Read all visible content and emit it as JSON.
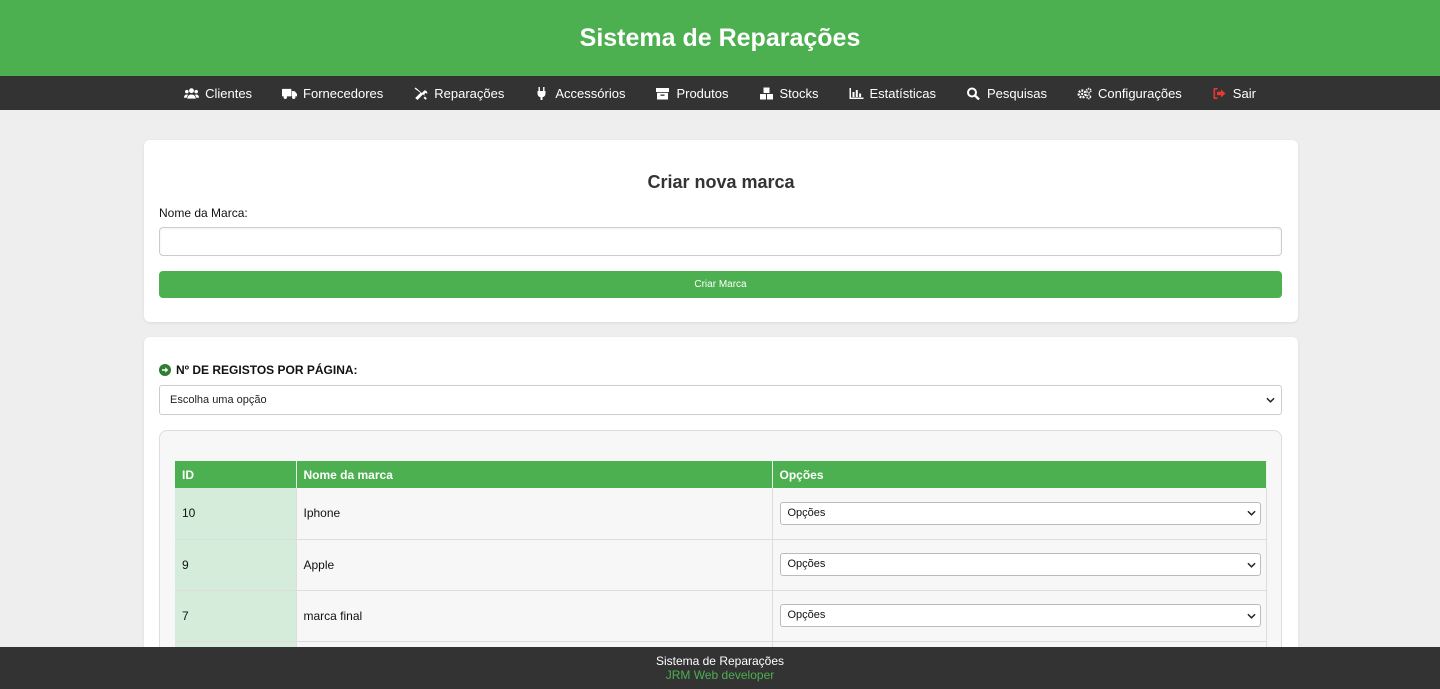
{
  "header": {
    "title": "Sistema de Reparações"
  },
  "nav": {
    "items": [
      {
        "label": "Clientes",
        "icon": "users-icon"
      },
      {
        "label": "Fornecedores",
        "icon": "truck-icon"
      },
      {
        "label": "Reparações",
        "icon": "tools-icon"
      },
      {
        "label": "Accessórios",
        "icon": "plug-icon"
      },
      {
        "label": "Produtos",
        "icon": "box-icon"
      },
      {
        "label": "Stocks",
        "icon": "boxes-icon"
      },
      {
        "label": "Estatísticas",
        "icon": "chart-icon"
      },
      {
        "label": "Pesquisas",
        "icon": "search-icon"
      },
      {
        "label": "Configurações",
        "icon": "gears-icon"
      },
      {
        "label": "Sair",
        "icon": "sign-out-icon"
      }
    ]
  },
  "create_form": {
    "title": "Criar nova marca",
    "name_label": "Nome da Marca:",
    "name_value": "",
    "submit_label": "Criar Marca"
  },
  "list": {
    "perpage_label": "Nº DE REGISTOS POR PÁGINA:",
    "perpage_value": "Escolha uma opção",
    "table": {
      "headers": [
        "ID",
        "Nome da marca",
        "Opções"
      ],
      "rows": [
        {
          "id": "10",
          "name": "Iphone",
          "option": "Opções"
        },
        {
          "id": "9",
          "name": "Apple",
          "option": "Opções"
        },
        {
          "id": "7",
          "name": "marca final",
          "option": "Opções"
        },
        {
          "id": "",
          "name": "",
          "option": ""
        }
      ]
    }
  },
  "footer": {
    "line1": "Sistema de Reparações",
    "line2": "JRM Web developer"
  },
  "colors": {
    "brand": "#4caf50",
    "nav_bg": "#333333",
    "id_cell_bg": "#d4ecd9",
    "logout_icon": "#e53935",
    "page_bg": "#eeeeee"
  }
}
